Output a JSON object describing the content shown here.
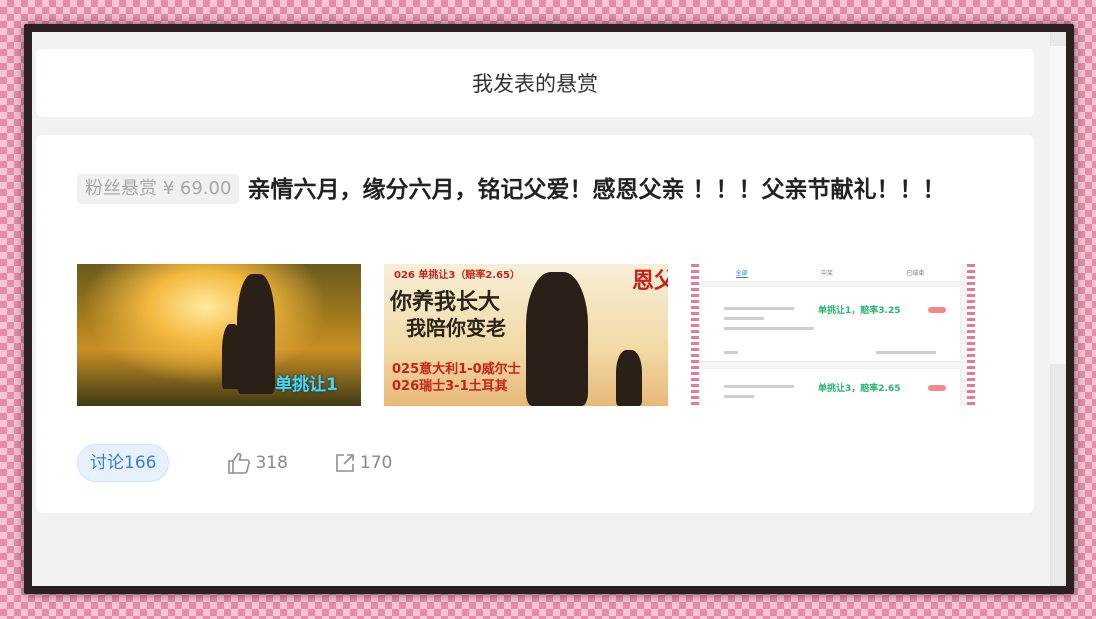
{
  "page": {
    "title": "我发表的悬赏"
  },
  "post": {
    "tag": "粉丝悬赏 ¥ 69.00",
    "heading": "亲情六月，缘分六月，铭记父爱！感恩父亲 ！！！父亲节献礼！！！",
    "images": [
      {
        "name": "father-son-sunset-image",
        "caption": "单挑让1"
      },
      {
        "name": "father-child-poster-image",
        "lines": [
          "026 单挑让3（赔率2.65）",
          "你养我长大",
          "我陪你变老",
          "025意大利1-0威尔士",
          "026瑞士3-1土耳其",
          "恩父亲"
        ]
      },
      {
        "name": "app-screenshot-image",
        "tabs": [
          "全部",
          "中奖",
          "已结束"
        ],
        "items": [
          "单挑让1，赔率3.25",
          "单挑让3，赔率2.65"
        ]
      }
    ]
  },
  "actions": {
    "discuss_label": "讨论166",
    "likes": "318",
    "shares": "170"
  },
  "colors": {
    "accent": "#3a7ad9",
    "background": "#f2f2f2",
    "card": "#ffffff"
  }
}
